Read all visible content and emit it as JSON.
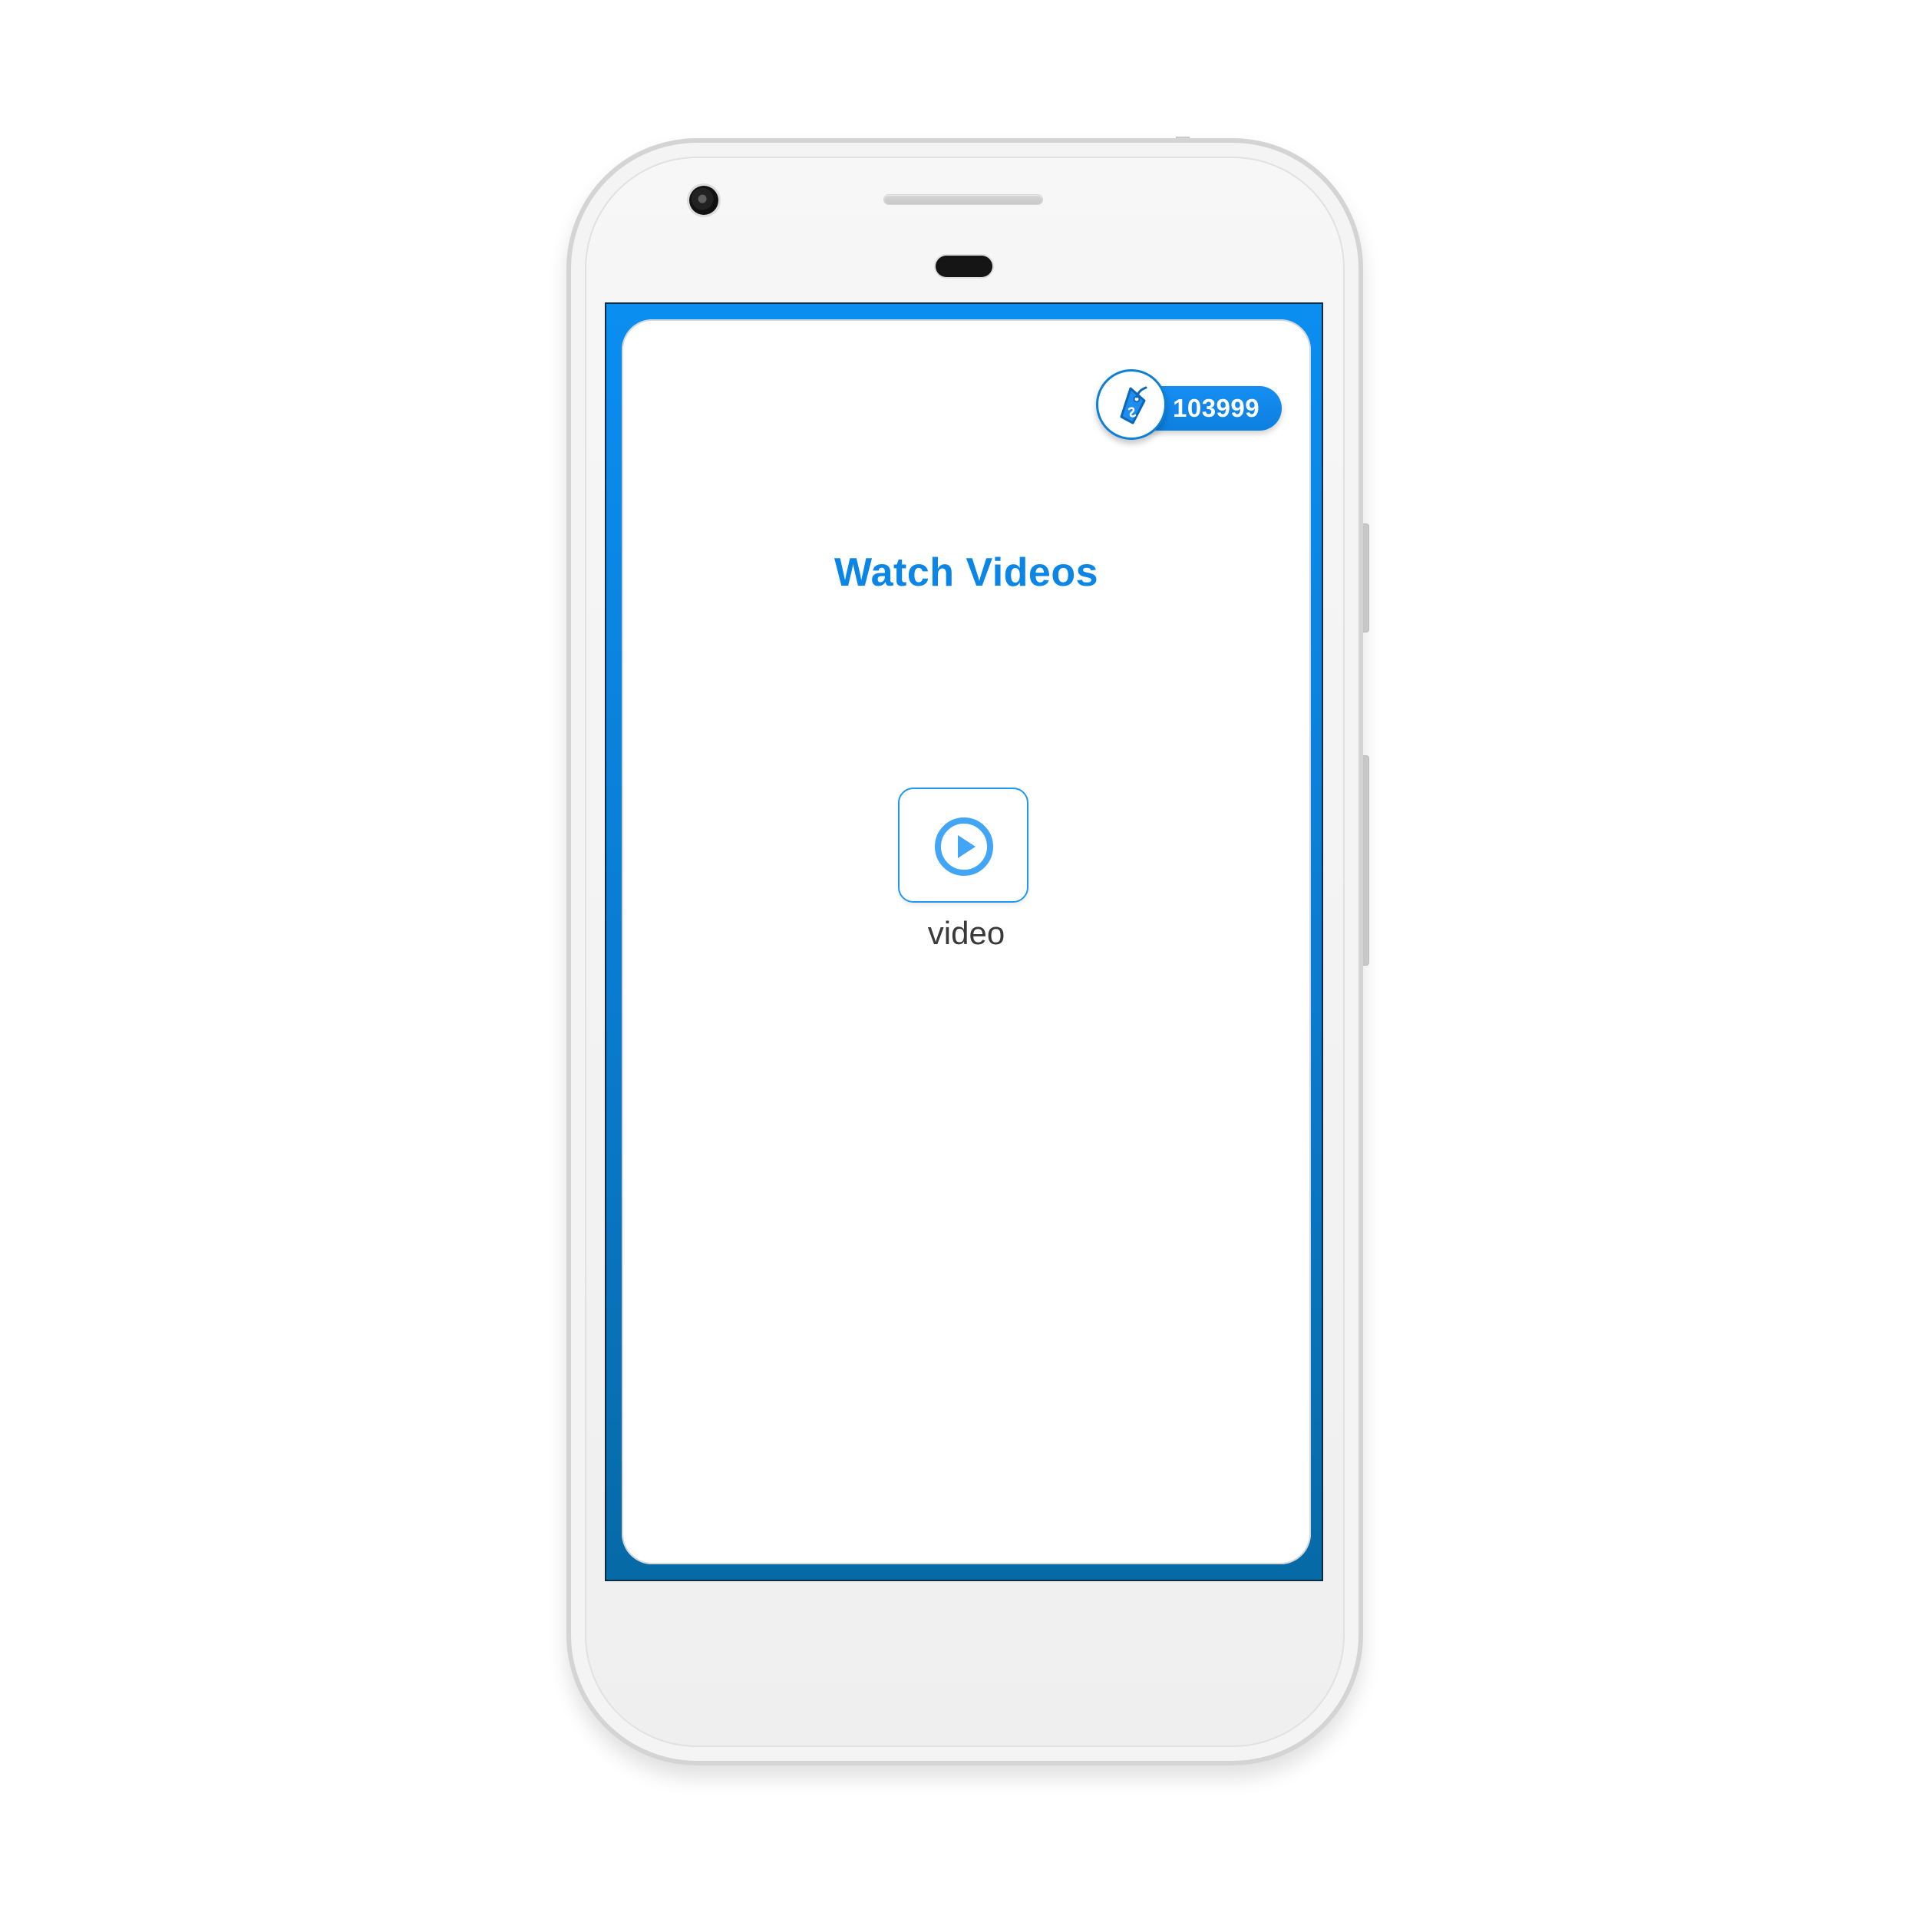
{
  "header": {
    "coin_count": "103999",
    "coin_icon": "tag-icon"
  },
  "main": {
    "title": "Watch Videos",
    "tile": {
      "label": "video",
      "icon": "play-circle-icon"
    }
  },
  "colors": {
    "accent": "#0B86E6",
    "screen_border": "#0A8EF0",
    "text_dark": "#3A3A3A"
  }
}
